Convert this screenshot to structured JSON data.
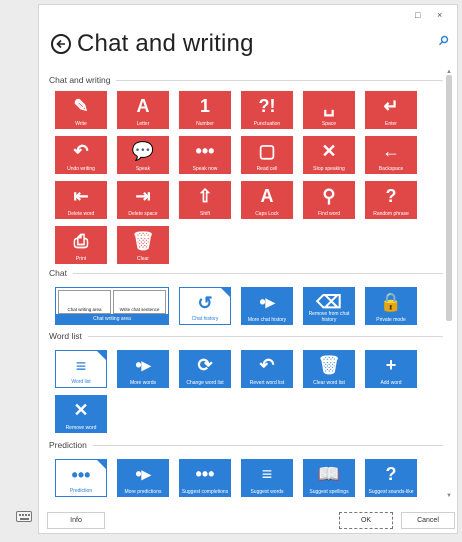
{
  "window": {
    "title": "Chat and writing",
    "controls": {
      "minimize": "‒",
      "restore": "□",
      "close": "×"
    }
  },
  "colors": {
    "red_tile": "#e04848",
    "blue_tile": "#2b7fd6",
    "background": "#ffffff"
  },
  "icons": {
    "back": "back-arrow-circle-icon",
    "search": "search-icon",
    "keyboard": "keyboard-icon"
  },
  "sections": {
    "chat_and_writing": {
      "title": "Chat and writing",
      "tiles": [
        {
          "label": "Write",
          "icon": "✎"
        },
        {
          "label": "Letter",
          "icon": "A"
        },
        {
          "label": "Number",
          "icon": "1"
        },
        {
          "label": "Punctuation",
          "icon": "?!"
        },
        {
          "label": "Space",
          "icon": "␣"
        },
        {
          "label": "Enter",
          "icon": "↵"
        },
        {
          "label": "Undo writing",
          "icon": "↶"
        },
        {
          "label": "Speak",
          "icon": "💬"
        },
        {
          "label": "Speak now",
          "icon": "•••"
        },
        {
          "label": "Read cell",
          "icon": "▢"
        },
        {
          "label": "Stop speaking",
          "icon": "✕"
        },
        {
          "label": "Backspace",
          "icon": "←"
        },
        {
          "label": "Delete word",
          "icon": "⇤"
        },
        {
          "label": "Delete space",
          "icon": "⇥"
        },
        {
          "label": "Shift",
          "icon": "⇧"
        },
        {
          "label": "Caps Lock",
          "icon": "A"
        },
        {
          "label": "Find word",
          "icon": "⚲"
        },
        {
          "label": "Random phrase",
          "icon": "?"
        },
        {
          "label": "Print",
          "icon": "⎙"
        },
        {
          "label": "Clear",
          "icon": "🗑"
        }
      ]
    },
    "chat": {
      "title": "Chat",
      "wide_tile": {
        "cell_1": "Chat writing area",
        "cell_2": "Write chat sentence",
        "label": "Chat writing area"
      },
      "tiles": [
        {
          "label": "Chat history",
          "icon": "↺"
        },
        {
          "label": "More chat history",
          "icon": "•▸"
        },
        {
          "label": "Remove from chat history",
          "icon": "⌫"
        },
        {
          "label": "Private mode",
          "icon": "🔒"
        }
      ]
    },
    "word_list": {
      "title": "Word list",
      "tiles": [
        {
          "label": "Word list",
          "icon": "≡"
        },
        {
          "label": "More words",
          "icon": "•▸"
        },
        {
          "label": "Change word list",
          "icon": "⟳"
        },
        {
          "label": "Revert word list",
          "icon": "↶"
        },
        {
          "label": "Clear word list",
          "icon": "🗑"
        },
        {
          "label": "Add word",
          "icon": "+"
        },
        {
          "label": "Remove word",
          "icon": "✕"
        }
      ]
    },
    "prediction": {
      "title": "Prediction",
      "tiles": [
        {
          "label": "Prediction",
          "icon": "•••"
        },
        {
          "label": "More predictions",
          "icon": "•▸"
        },
        {
          "label": "Suggest completions",
          "icon": "•••"
        },
        {
          "label": "Suggest words",
          "icon": "≡"
        },
        {
          "label": "Suggest spellings",
          "icon": "📖"
        },
        {
          "label": "Suggest sounds-like",
          "icon": "?"
        }
      ]
    }
  },
  "footer": {
    "info": "Info",
    "ok": "OK",
    "cancel": "Cancel"
  }
}
